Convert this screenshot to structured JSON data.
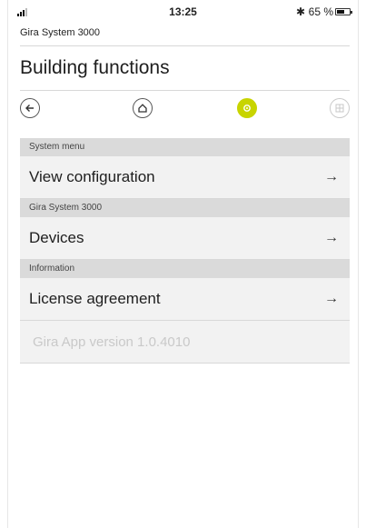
{
  "status_bar": {
    "time": "13:25",
    "bluetooth_icon": "bluetooth-icon",
    "battery_percent": "65 %",
    "battery_level": 0.65
  },
  "app_name": "Gira System 3000",
  "page_title": "Building functions",
  "nav": {
    "back_icon": "arrow-left-icon",
    "home_icon": "home-icon",
    "settings_icon": "gear-icon",
    "grid_icon": "grid-icon",
    "active_color": "#c8d400"
  },
  "sections": [
    {
      "header": "System menu",
      "item": "View configuration",
      "arrow": "→"
    },
    {
      "header": "Gira System 3000",
      "item": "Devices",
      "arrow": "→"
    },
    {
      "header": "Information",
      "item": "License agreement",
      "arrow": "→"
    }
  ],
  "version_text": "Gira App version 1.0.4010"
}
